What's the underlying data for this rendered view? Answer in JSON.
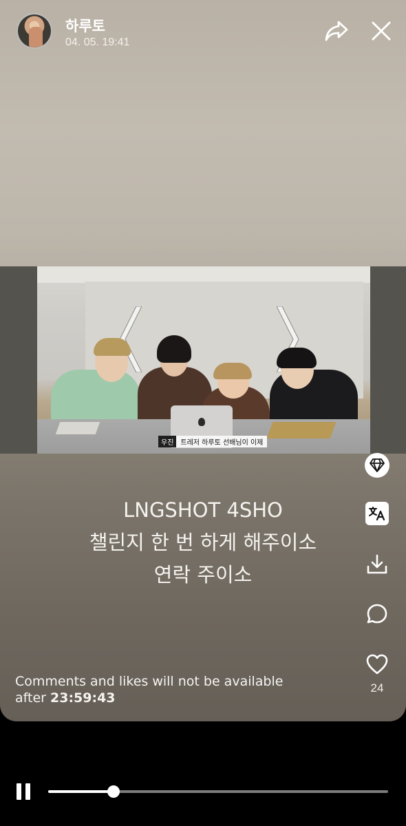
{
  "header": {
    "user_name": "하루토",
    "timestamp": "04. 05. 19:41",
    "share_icon": "share-arrow-icon",
    "close_icon": "close-icon"
  },
  "video": {
    "subtitle_speaker": "우진",
    "subtitle_text": "트레저 하루토 선배님이 이제"
  },
  "caption": {
    "lines": [
      "LNGSHOT 4SHO",
      "챌린지 한 번 하게 해주이소",
      "연락 주이소"
    ]
  },
  "actions": {
    "gem_icon": "diamond-icon",
    "translate_icon": "translate-icon",
    "download_icon": "download-icon",
    "comment_icon": "comment-icon",
    "like_icon": "heart-icon",
    "like_count": "24"
  },
  "notice": {
    "prefix": "Comments and likes will not be available after ",
    "time": "23:59:43"
  },
  "player": {
    "state_icon": "pause-icon",
    "progress": 0.192
  }
}
